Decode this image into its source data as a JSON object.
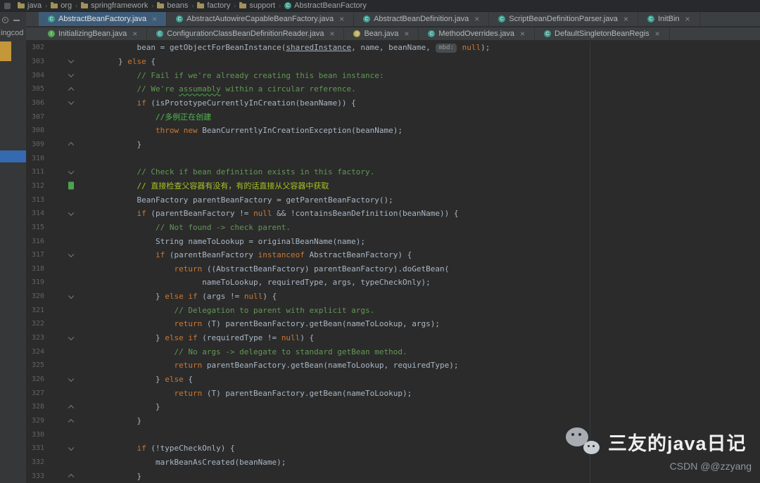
{
  "colors": {
    "p": "#A9B7C6",
    "k": "#CC7832",
    "c": "#629755",
    "cb": "#4DBB4D",
    "ct": "#A8C023",
    "ln": "#606366"
  },
  "breadcrumb": {
    "separator": "›",
    "items": [
      {
        "label": "java",
        "type": "folder"
      },
      {
        "label": "org",
        "type": "folder"
      },
      {
        "label": "springframework",
        "type": "folder"
      },
      {
        "label": "beans",
        "type": "folder"
      },
      {
        "label": "factory",
        "type": "folder"
      },
      {
        "label": "support",
        "type": "folder"
      },
      {
        "label": "AbstractBeanFactory",
        "type": "class"
      }
    ]
  },
  "tabs_row1": [
    {
      "label": "AbstractBeanFactory.java",
      "icon": "C",
      "active": true
    },
    {
      "label": "AbstractAutowireCapableBeanFactory.java",
      "icon": "C",
      "active": false
    },
    {
      "label": "AbstractBeanDefinition.java",
      "icon": "C",
      "active": false
    },
    {
      "label": "ScriptBeanDefinitionParser.java",
      "icon": "C",
      "active": false
    },
    {
      "label": "InitBin",
      "icon": "C",
      "active": false
    }
  ],
  "tabs_row2": [
    {
      "label": "InitializingBean.java",
      "icon": "I",
      "active": false
    },
    {
      "label": "ConfigurationClassBeanDefinitionReader.java",
      "icon": "C",
      "active": false
    },
    {
      "label": "Bean.java",
      "icon": "@",
      "active": false
    },
    {
      "label": "MethodOverrides.java",
      "icon": "C",
      "active": false
    },
    {
      "label": "DefaultSingletonBeanRegis",
      "icon": "C",
      "active": false
    }
  ],
  "left_panel": {
    "partial_text": "ingcod"
  },
  "editor": {
    "file": "AbstractBeanFactory.java",
    "lines": [
      {
        "n": 302,
        "ind": 12,
        "t": [
          [
            "p",
            "bean = getObjectForBeanInstance("
          ],
          [
            "u",
            "sharedInstance"
          ],
          [
            "p",
            ", name, beanName, "
          ],
          [
            "h",
            "mbd:"
          ],
          [
            "p",
            " "
          ],
          [
            "k",
            "null"
          ],
          [
            "p",
            ");"
          ]
        ]
      },
      {
        "n": 303,
        "ind": 8,
        "g": "down",
        "t": [
          [
            "p",
            "} "
          ],
          [
            "k",
            "else"
          ],
          [
            "p",
            " {"
          ]
        ]
      },
      {
        "n": 304,
        "ind": 12,
        "g": "down",
        "t": [
          [
            "c",
            "// Fail if we're already creating this bean instance:"
          ]
        ]
      },
      {
        "n": 305,
        "ind": 12,
        "g": "up",
        "t": [
          [
            "c",
            "// We're "
          ],
          [
            "cw",
            "assumably"
          ],
          [
            "c",
            " within a circular reference."
          ]
        ]
      },
      {
        "n": 306,
        "ind": 12,
        "g": "down",
        "t": [
          [
            "k",
            "if"
          ],
          [
            "p",
            " (isPrototypeCurrentlyInCreation(beanName)) {"
          ]
        ]
      },
      {
        "n": 307,
        "ind": 16,
        "t": [
          [
            "cb",
            "//多例正在创建"
          ]
        ]
      },
      {
        "n": 308,
        "ind": 16,
        "t": [
          [
            "k",
            "throw"
          ],
          [
            "p",
            " "
          ],
          [
            "k",
            "new"
          ],
          [
            "p",
            " BeanCurrentlyInCreationException(beanName);"
          ]
        ]
      },
      {
        "n": 309,
        "ind": 12,
        "g": "up",
        "t": [
          [
            "p",
            "}"
          ]
        ]
      },
      {
        "n": 310,
        "ind": 0,
        "t": []
      },
      {
        "n": 311,
        "ind": 12,
        "g": "down",
        "t": [
          [
            "c",
            "// Check if bean definition exists in this factory."
          ]
        ]
      },
      {
        "n": 312,
        "ind": 12,
        "g": "bm",
        "t": [
          [
            "ct",
            "// 直接检查父容器有没有，有的话直接从父容器中获取"
          ]
        ]
      },
      {
        "n": 313,
        "ind": 12,
        "t": [
          [
            "p",
            "BeanFactory parentBeanFactory = getParentBeanFactory();"
          ]
        ]
      },
      {
        "n": 314,
        "ind": 12,
        "g": "down",
        "t": [
          [
            "k",
            "if"
          ],
          [
            "p",
            " (parentBeanFactory != "
          ],
          [
            "k",
            "null"
          ],
          [
            "p",
            " && !containsBeanDefinition(beanName)) {"
          ]
        ]
      },
      {
        "n": 315,
        "ind": 16,
        "t": [
          [
            "c",
            "// Not found -> check parent."
          ]
        ]
      },
      {
        "n": 316,
        "ind": 16,
        "t": [
          [
            "p",
            "String nameToLookup = originalBeanName(name);"
          ]
        ]
      },
      {
        "n": 317,
        "ind": 16,
        "g": "down",
        "t": [
          [
            "k",
            "if"
          ],
          [
            "p",
            " (parentBeanFactory "
          ],
          [
            "k",
            "instanceof"
          ],
          [
            "p",
            " AbstractBeanFactory) {"
          ]
        ]
      },
      {
        "n": 318,
        "ind": 20,
        "t": [
          [
            "k",
            "return"
          ],
          [
            "p",
            " ((AbstractBeanFactory) parentBeanFactory).doGetBean("
          ]
        ]
      },
      {
        "n": 319,
        "ind": 26,
        "t": [
          [
            "p",
            "nameToLookup, requiredType, args, typeCheckOnly);"
          ]
        ]
      },
      {
        "n": 320,
        "ind": 16,
        "g": "down",
        "t": [
          [
            "p",
            "} "
          ],
          [
            "k",
            "else"
          ],
          [
            "p",
            " "
          ],
          [
            "k",
            "if"
          ],
          [
            "p",
            " (args != "
          ],
          [
            "k",
            "null"
          ],
          [
            "p",
            ") {"
          ]
        ]
      },
      {
        "n": 321,
        "ind": 20,
        "t": [
          [
            "c",
            "// Delegation to parent with explicit args."
          ]
        ]
      },
      {
        "n": 322,
        "ind": 20,
        "t": [
          [
            "k",
            "return"
          ],
          [
            "p",
            " (T) parentBeanFactory.getBean(nameToLookup, args);"
          ]
        ]
      },
      {
        "n": 323,
        "ind": 16,
        "g": "down",
        "t": [
          [
            "p",
            "} "
          ],
          [
            "k",
            "else"
          ],
          [
            "p",
            " "
          ],
          [
            "k",
            "if"
          ],
          [
            "p",
            " (requiredType != "
          ],
          [
            "k",
            "null"
          ],
          [
            "p",
            ") {"
          ]
        ]
      },
      {
        "n": 324,
        "ind": 20,
        "t": [
          [
            "c",
            "// No args -> delegate to standard getBean method."
          ]
        ]
      },
      {
        "n": 325,
        "ind": 20,
        "t": [
          [
            "k",
            "return"
          ],
          [
            "p",
            " parentBeanFactory.getBean(nameToLookup, requiredType);"
          ]
        ]
      },
      {
        "n": 326,
        "ind": 16,
        "g": "down",
        "t": [
          [
            "p",
            "} "
          ],
          [
            "k",
            "else"
          ],
          [
            "p",
            " {"
          ]
        ]
      },
      {
        "n": 327,
        "ind": 20,
        "t": [
          [
            "k",
            "return"
          ],
          [
            "p",
            " (T) parentBeanFactory.getBean(nameToLookup);"
          ]
        ]
      },
      {
        "n": 328,
        "ind": 16,
        "g": "up",
        "t": [
          [
            "p",
            "}"
          ]
        ]
      },
      {
        "n": 329,
        "ind": 12,
        "g": "up",
        "t": [
          [
            "p",
            "}"
          ]
        ]
      },
      {
        "n": 330,
        "ind": 0,
        "t": []
      },
      {
        "n": 331,
        "ind": 12,
        "g": "down",
        "t": [
          [
            "k",
            "if"
          ],
          [
            "p",
            " (!typeCheckOnly) {"
          ]
        ]
      },
      {
        "n": 332,
        "ind": 16,
        "t": [
          [
            "p",
            "markBeanAsCreated(beanName);"
          ]
        ]
      },
      {
        "n": 333,
        "ind": 12,
        "g": "up",
        "t": [
          [
            "p",
            "}"
          ]
        ]
      }
    ]
  },
  "watermark": {
    "title": "三友的java日记",
    "subtitle": "CSDN @@zzyang"
  }
}
